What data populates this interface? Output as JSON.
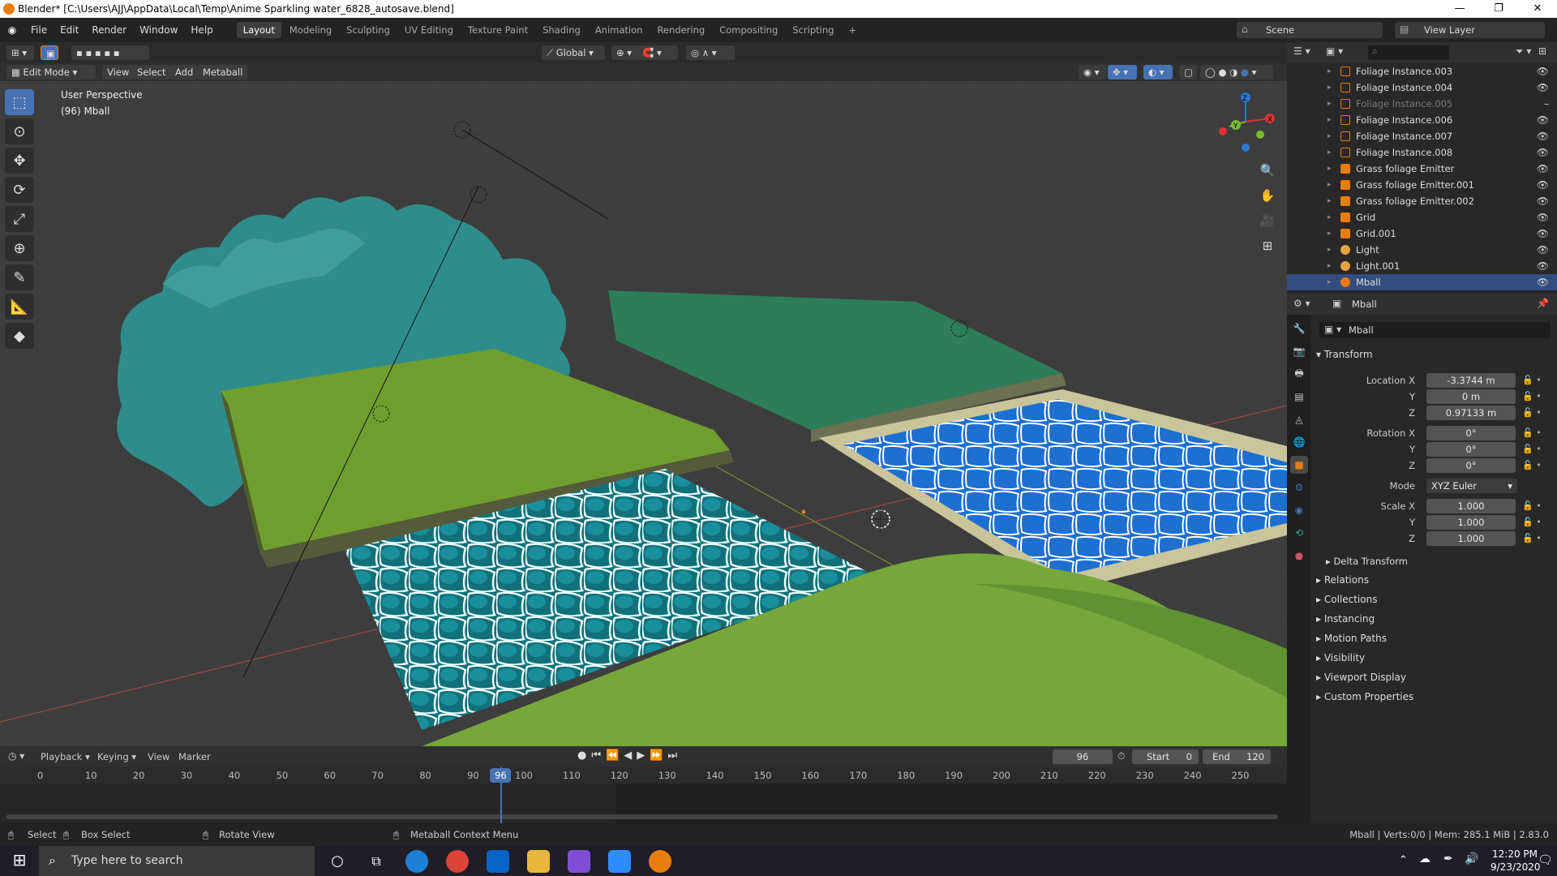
{
  "window": {
    "title": "Blender* [C:\\Users\\AJJ\\AppData\\Local\\Temp\\Anime Sparkling water_6828_autosave.blend]"
  },
  "menus": [
    "File",
    "Edit",
    "Render",
    "Window",
    "Help"
  ],
  "workspaces": [
    "Layout",
    "Modeling",
    "Sculpting",
    "UV Editing",
    "Texture Paint",
    "Shading",
    "Animation",
    "Rendering",
    "Compositing",
    "Scripting"
  ],
  "scene": {
    "label": "Scene",
    "view_layer": "View Layer"
  },
  "viewport": {
    "transform": "Global",
    "mode": "Edit Mode",
    "menus": [
      "View",
      "Select",
      "Add",
      "Metaball"
    ],
    "perspective": "User Perspective",
    "object_info": "(96) Mball"
  },
  "outliner": {
    "items": [
      {
        "name": "Foliage Instance.003",
        "type": "collection"
      },
      {
        "name": "Foliage Instance.004",
        "type": "collection"
      },
      {
        "name": "Foliage Instance.005",
        "type": "collection",
        "dim": true
      },
      {
        "name": "Foliage Instance.006",
        "type": "collection"
      },
      {
        "name": "Foliage Instance.007",
        "type": "collection"
      },
      {
        "name": "Foliage Instance.008",
        "type": "collection"
      },
      {
        "name": "Grass foliage Emitter",
        "type": "mesh"
      },
      {
        "name": "Grass foliage Emitter.001",
        "type": "mesh"
      },
      {
        "name": "Grass foliage Emitter.002",
        "type": "mesh"
      },
      {
        "name": "Grid",
        "type": "mesh"
      },
      {
        "name": "Grid.001",
        "type": "mesh"
      },
      {
        "name": "Light",
        "type": "light"
      },
      {
        "name": "Light.001",
        "type": "light"
      },
      {
        "name": "Mball",
        "type": "meta",
        "selected": true
      }
    ]
  },
  "properties": {
    "header_object": "Mball",
    "name_field": "Mball",
    "transform_label": "Transform",
    "location": {
      "label_x": "Location X",
      "x": "-3.3744 m",
      "y": "0 m",
      "z": "0.97133 m"
    },
    "rotation": {
      "label_x": "Rotation X",
      "x": "0°",
      "y": "0°",
      "z": "0°"
    },
    "mode_label": "Mode",
    "mode_value": "XYZ Euler",
    "scale": {
      "label_x": "Scale X",
      "x": "1.000",
      "y": "1.000",
      "z": "1.000"
    },
    "axis_y": "Y",
    "axis_z": "Z",
    "sections": [
      "Delta Transform",
      "Relations",
      "Collections",
      "Instancing",
      "Motion Paths",
      "Visibility",
      "Viewport Display",
      "Custom Properties"
    ]
  },
  "timeline": {
    "menus": [
      "Playback",
      "Keying",
      "View",
      "Marker"
    ],
    "current_frame": "96",
    "start_label": "Start",
    "start": "0",
    "end_label": "End",
    "end": "120",
    "ticks": [
      "0",
      "10",
      "20",
      "30",
      "40",
      "50",
      "60",
      "70",
      "80",
      "90",
      "100",
      "110",
      "120",
      "130",
      "140",
      "150",
      "160",
      "170",
      "180",
      "190",
      "200",
      "210",
      "220",
      "230",
      "240",
      "250"
    ]
  },
  "statusbar": {
    "left": [
      "Select",
      "Box Select",
      "Rotate View",
      "Metaball Context Menu"
    ],
    "right": "Mball | Verts:0/0 | Mem: 285.1 MiB | 2.83.0"
  },
  "taskbar": {
    "search_placeholder": "Type here to search",
    "time": "12:20 PM",
    "date": "9/23/2020"
  },
  "colors": {
    "accent": "#4772b3",
    "blender_orange": "#e87d0d",
    "selected_row": "#334d80"
  }
}
